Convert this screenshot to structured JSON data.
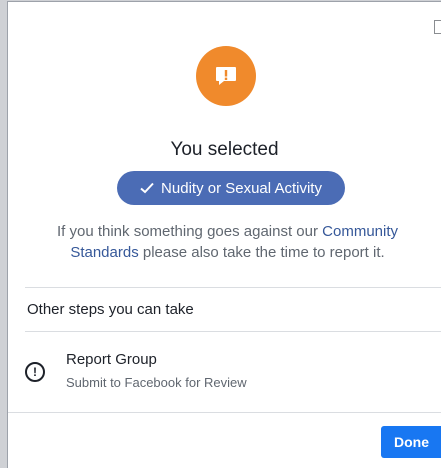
{
  "dialog": {
    "title": "You selected",
    "selected_tag": "Nudity or Sexual Activity",
    "info_before": "If you think something goes against our ",
    "info_link": "Community Standards",
    "info_after": " please also take the time to report it.",
    "section_heading": "Other steps you can take",
    "step": {
      "label": "Report Group",
      "sublabel": "Submit to Facebook for Review",
      "icon": "alert-circle-outline-icon"
    },
    "done_label": "Done",
    "header_icon": "alert-speech-bubble-icon"
  },
  "colors": {
    "accent_orange": "#f08a2c",
    "pill_blue": "#4b6cb5",
    "link_blue": "#365899",
    "button_blue": "#1877f2"
  }
}
